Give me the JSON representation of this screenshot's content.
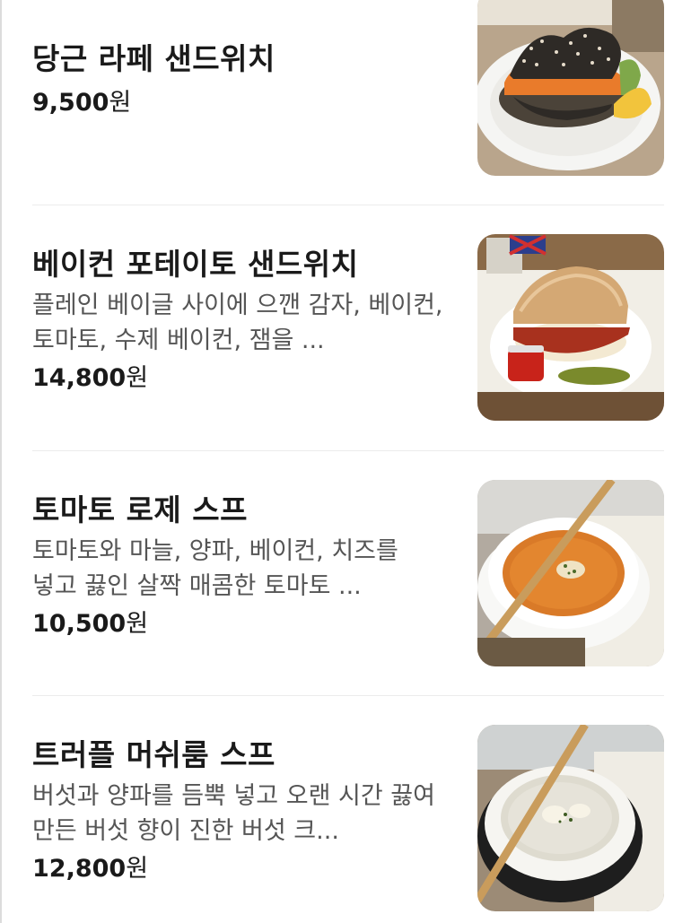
{
  "menu": {
    "items": [
      {
        "name": "당근 라페 샌드위치",
        "description": "",
        "price": "9,500",
        "currency": "원",
        "image": "carrot-rape-sandwich-photo"
      },
      {
        "name": "베이컨 포테이토 샌드위치",
        "description": "플레인 베이글 사이에 으깬 감자, 베이컨, 토마토, 수제 베이컨, 잼을 ...",
        "price": "14,800",
        "currency": "원",
        "image": "bacon-potato-sandwich-photo"
      },
      {
        "name": "토마토 로제 스프",
        "description": "토마토와 마늘, 양파, 베이컨, 치즈를 넣고 끓인 살짝 매콤한 토마토 ...",
        "price": "10,500",
        "currency": "원",
        "image": "tomato-rose-soup-photo"
      },
      {
        "name": "트러플 머쉬룸 스프",
        "description": "버섯과 양파를 듬뿍 넣고 오랜 시간 끓여 만든 버섯 향이 진한 버섯 크...",
        "price": "12,800",
        "currency": "원",
        "image": "truffle-mushroom-soup-photo"
      }
    ]
  }
}
